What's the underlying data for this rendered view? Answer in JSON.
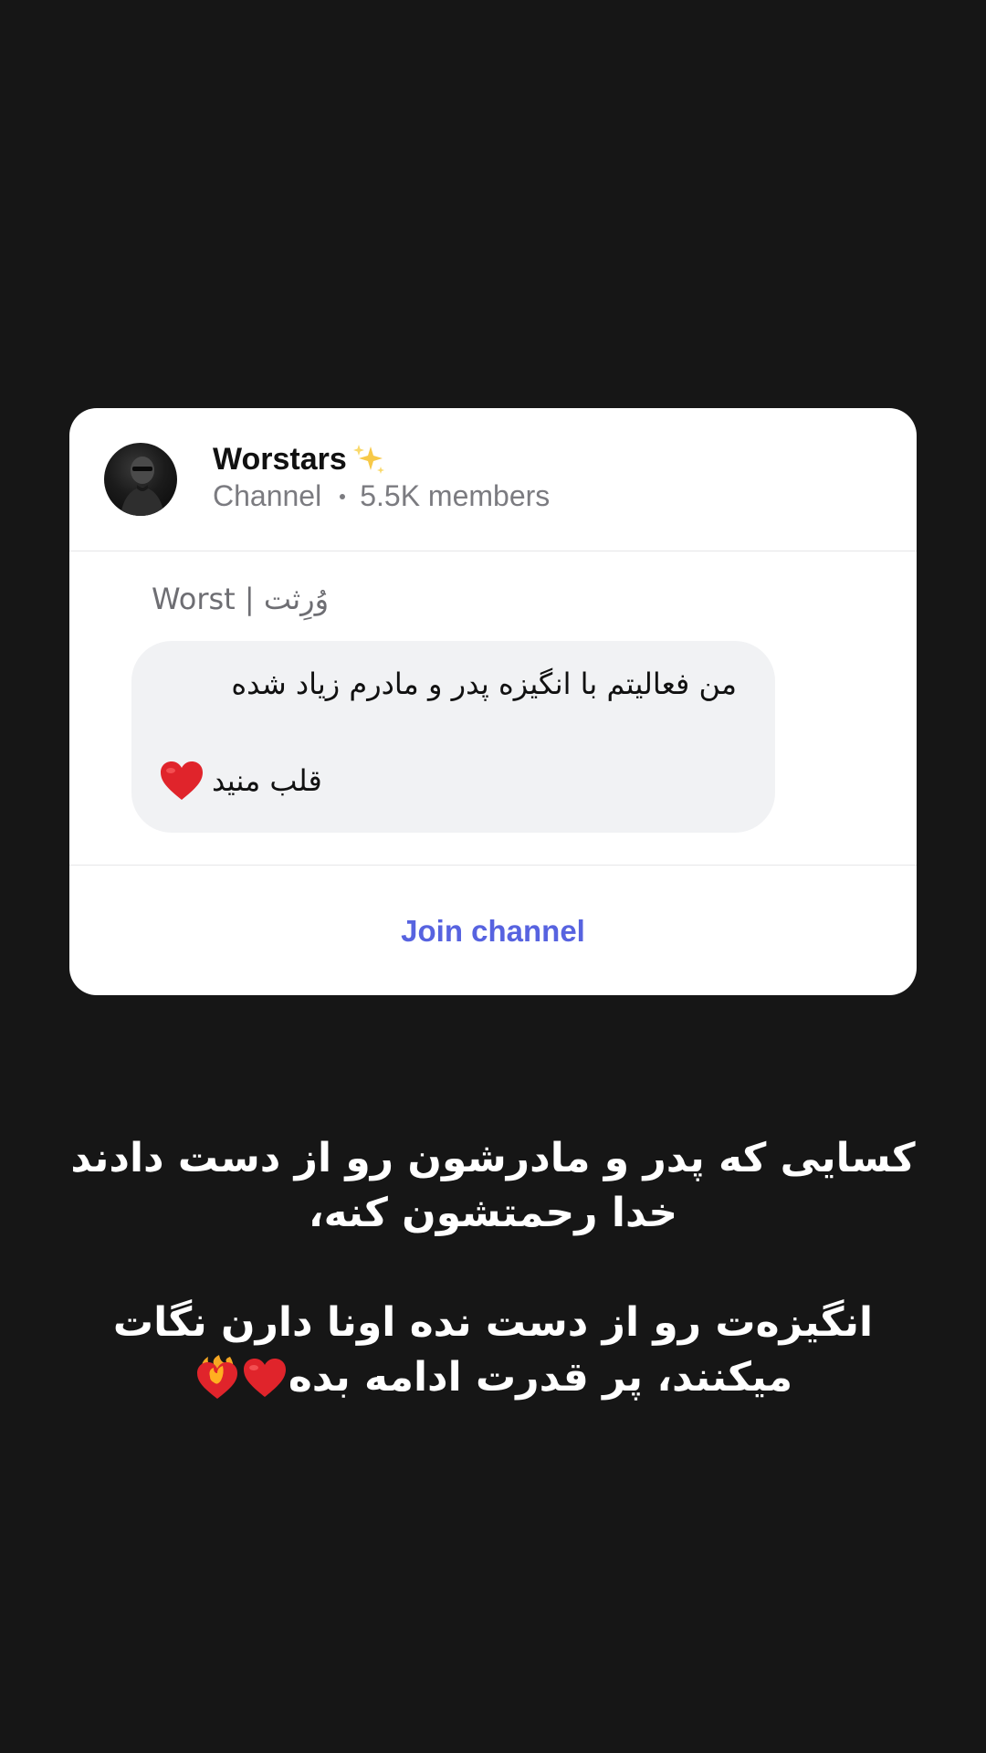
{
  "card": {
    "channel_name": "Worstars",
    "name_icon": "sparkles-icon",
    "channel_type": "Channel",
    "members": "5.5K members",
    "author": "Worst | وُرِثت",
    "message_line1": "من فعالیتم با انگیزه پدر و مادرم زیاد شده",
    "message_line2": "قلب منید",
    "message_icon": "red-heart-icon",
    "join_label": "Join channel"
  },
  "caption": {
    "line1": "کسایی که پدر و مادرشون رو از دست دادند",
    "line2": "خدا رحمتشون کنه،",
    "line3": "انگیزه‌ت رو از دست نده اونا دارن نگات",
    "line4": "میکنند، پر قدرت ادامه بده",
    "line4_icons": [
      "red-heart-icon",
      "heart-on-fire-icon"
    ]
  },
  "colors": {
    "background": "#161616",
    "card": "#ffffff",
    "bubble": "#f1f2f4",
    "accent": "#5763e0",
    "muted_text": "#7b7b80"
  }
}
